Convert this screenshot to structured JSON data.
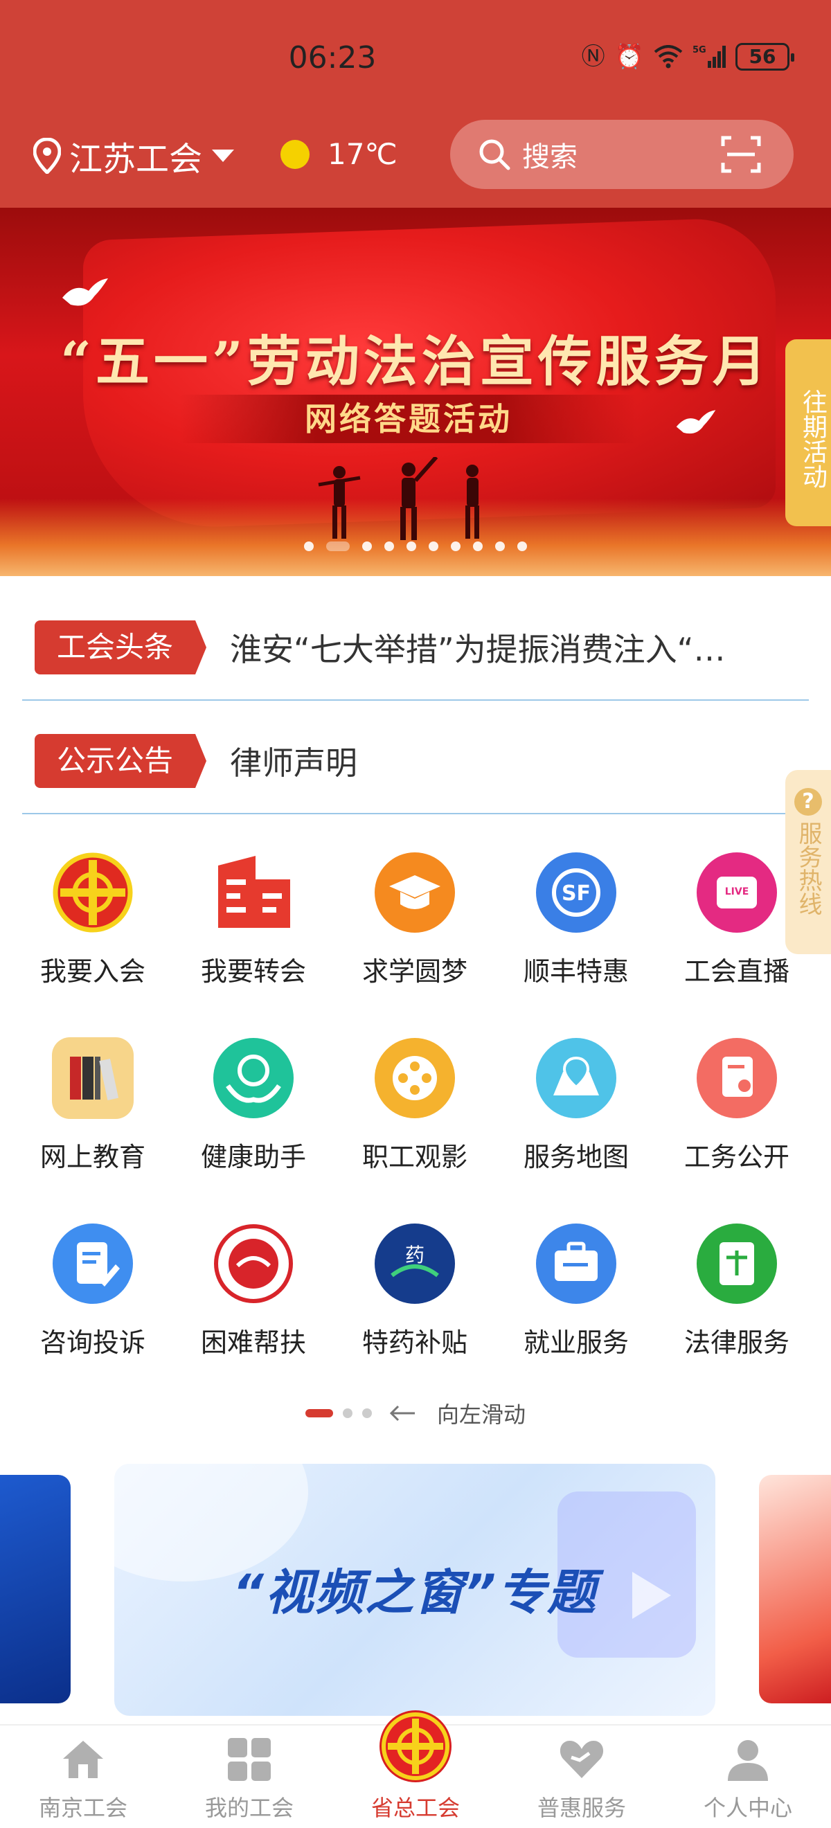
{
  "status_bar": {
    "time": "06:23",
    "battery": "56",
    "network": "5G"
  },
  "header": {
    "location": "江苏工会",
    "temperature": "17℃",
    "search_placeholder": "搜索"
  },
  "banner": {
    "title": "“五一”劳动法治宣传服务月",
    "subtitle": "网络答题活动",
    "side_tab": "往期活动",
    "slide_count": 10,
    "active_slide": 2
  },
  "news": [
    {
      "tag": "工会头条",
      "text": "淮安“七大举措”为提振消费注入“…"
    },
    {
      "tag": "公示公告",
      "text": "律师声明"
    }
  ],
  "hotline": "服务热线",
  "services": [
    {
      "label": "我要入会",
      "icon": "union-emblem-icon",
      "color": "#e02a20"
    },
    {
      "label": "我要转会",
      "icon": "building-icon",
      "color": "#e63a2e"
    },
    {
      "label": "求学圆梦",
      "icon": "graduation-cap-icon",
      "color": "#f58a1f"
    },
    {
      "label": "顺丰特惠",
      "icon": "sf-express-icon",
      "color": "#3a7fe6"
    },
    {
      "label": "工会直播",
      "icon": "live-tv-icon",
      "color": "#e42a82"
    },
    {
      "label": "网上教育",
      "icon": "books-icon",
      "color": "#f7d58a"
    },
    {
      "label": "健康助手",
      "icon": "health-hands-icon",
      "color": "#1fc39a"
    },
    {
      "label": "职工观影",
      "icon": "film-reel-icon",
      "color": "#f5b22e"
    },
    {
      "label": "服务地图",
      "icon": "map-pin-icon",
      "color": "#4fc3e8"
    },
    {
      "label": "工务公开",
      "icon": "document-person-icon",
      "color": "#f36c63"
    },
    {
      "label": "咨询投诉",
      "icon": "edit-document-icon",
      "color": "#3f8ef0"
    },
    {
      "label": "困难帮扶",
      "icon": "assistance-seal-icon",
      "color": "#d8242a"
    },
    {
      "label": "特药补贴",
      "icon": "medicine-icon",
      "color": "#153c8c"
    },
    {
      "label": "就业服务",
      "icon": "briefcase-icon",
      "color": "#3d86ea"
    },
    {
      "label": "法律服务",
      "icon": "law-book-icon",
      "color": "#2aac3f"
    }
  ],
  "grid_pager": {
    "pages": 3,
    "active": 0,
    "hint": "向左滑动"
  },
  "video_card": {
    "title": "“视频之窗”专题"
  },
  "bottom_nav": [
    {
      "label": "南京工会",
      "icon": "home-icon",
      "active": false
    },
    {
      "label": "我的工会",
      "icon": "grid-icon",
      "active": false
    },
    {
      "label": "省总工会",
      "icon": "union-emblem-icon",
      "active": true
    },
    {
      "label": "普惠服务",
      "icon": "heart-icon",
      "active": false
    },
    {
      "label": "个人中心",
      "icon": "person-icon",
      "active": false
    }
  ],
  "colors": {
    "header": "#cf4237",
    "accent": "#d63b30",
    "divider": "#9cc8e8"
  }
}
